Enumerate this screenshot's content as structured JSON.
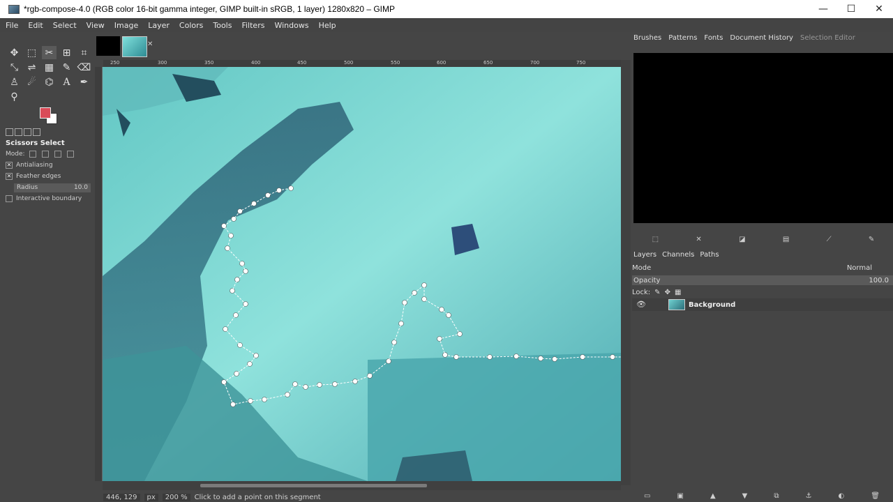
{
  "window": {
    "title": "*rgb-compose-4.0 (RGB color 16-bit gamma integer, GIMP built-in sRGB, 1 layer) 1280x820 – GIMP",
    "controls": {
      "minimize": "—",
      "maximize": "☐",
      "close": "✕"
    }
  },
  "menu": [
    "File",
    "Edit",
    "Select",
    "View",
    "Image",
    "Layer",
    "Colors",
    "Tools",
    "Filters",
    "Windows",
    "Help"
  ],
  "toolbox": {
    "colors": {
      "foreground": "#d94b58",
      "background": "#ffffff"
    }
  },
  "tool_options": {
    "title": "Scissors Select",
    "mode_label": "Mode:",
    "antialiasing": "Antialiasing",
    "feather_edges": "Feather edges",
    "radius_label": "Radius",
    "radius_value": "10.0",
    "interactive_boundary": "Interactive boundary"
  },
  "ruler": {
    "top_marks": [
      "250",
      "300",
      "350",
      "400",
      "450",
      "500",
      "550",
      "600",
      "650",
      "700",
      "750"
    ]
  },
  "status": {
    "coords": "446, 129",
    "unit": "px",
    "zoom": "200 %",
    "message": "Click to add a point on this segment"
  },
  "dock_top": {
    "tabs": [
      "Brushes",
      "Patterns",
      "Fonts",
      "Document History",
      "Selection Editor"
    ]
  },
  "layers_dock": {
    "tabs": [
      "Layers",
      "Channels",
      "Paths"
    ],
    "mode_label": "Mode",
    "mode_value": "Normal",
    "opacity_label": "Opacity",
    "opacity_value": "100.0",
    "lock_label": "Lock:",
    "layer_name": "Background"
  }
}
